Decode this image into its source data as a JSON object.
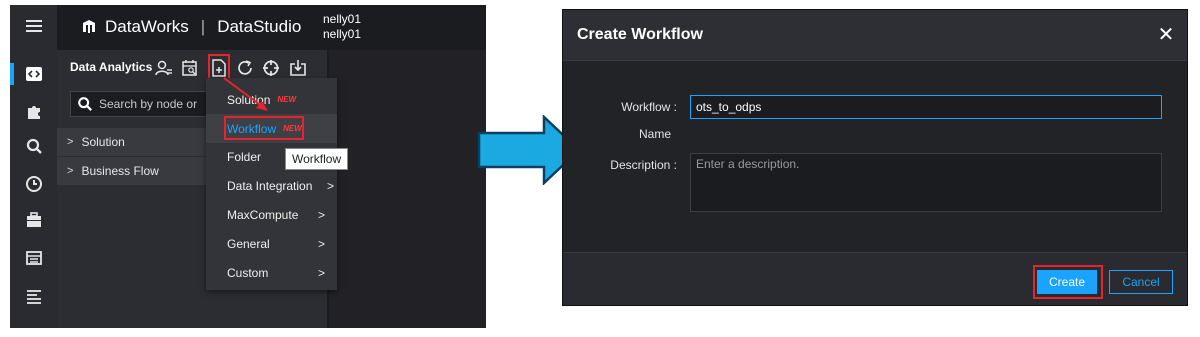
{
  "left_panel": {
    "app": {
      "brand_name": "DataWorks",
      "separator": "|",
      "module_name": "DataStudio",
      "user_line_1": "nelly01",
      "user_line_2": "nelly01"
    },
    "rail_icons": [
      "menu-icon",
      "code-icon",
      "puzzle-icon",
      "search-icon",
      "clock-icon",
      "briefcase-icon",
      "table-icon",
      "list-icon"
    ],
    "explorer": {
      "title": "Data Analytics",
      "toolbar_icons": [
        "user-filter-icon",
        "calendar-search-icon",
        "create-file-icon",
        "refresh-icon",
        "locate-icon",
        "import-icon"
      ],
      "search_placeholder": "Search by node or",
      "tree": [
        {
          "label": "Solution"
        },
        {
          "label": "Business Flow"
        }
      ]
    },
    "new_menu": {
      "items": [
        {
          "label": "Solution",
          "badge": "NEW",
          "has_submenu": false
        },
        {
          "label": "Workflow",
          "badge": "NEW",
          "has_submenu": false
        },
        {
          "label": "Folder",
          "badge": "",
          "has_submenu": false
        },
        {
          "label": "Data Integration",
          "badge": "",
          "has_submenu": true
        },
        {
          "label": "MaxCompute",
          "badge": "",
          "has_submenu": true
        },
        {
          "label": "General",
          "badge": "",
          "has_submenu": true
        },
        {
          "label": "Custom",
          "badge": "",
          "has_submenu": true
        }
      ],
      "tooltip": "Workflow"
    }
  },
  "dialog": {
    "title": "Create Workflow",
    "workflow_name_label_line1": "Workflow :",
    "workflow_name_label_line2": "Name",
    "workflow_name_value": "ots_to_odps",
    "description_label": "Description :",
    "description_placeholder": "Enter a description.",
    "create_label": "Create",
    "cancel_label": "Cancel"
  },
  "colors": {
    "accent": "#1aa3ff",
    "highlight": "#e5242b",
    "arrow": "#1aa9e0"
  }
}
